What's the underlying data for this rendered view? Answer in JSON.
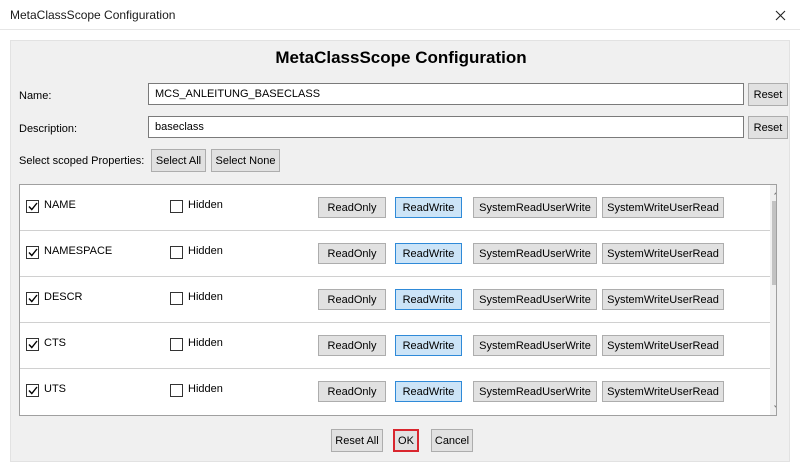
{
  "window": {
    "title": "MetaClassScope Configuration"
  },
  "header": {
    "title": "MetaClassScope Configuration"
  },
  "form": {
    "name_label": "Name:",
    "name_value": "MCS_ANLEITUNG_BASECLASS",
    "description_label": "Description:",
    "description_value": "baseclass",
    "reset_label": "Reset",
    "select_label": "Select scoped Properties:",
    "select_all_label": "Select All",
    "select_none_label": "Select None"
  },
  "rows": [
    {
      "name": "NAME",
      "checked": true,
      "hidden_label": "Hidden",
      "hidden": false,
      "mode": "ReadWrite"
    },
    {
      "name": "NAMESPACE",
      "checked": true,
      "hidden_label": "Hidden",
      "hidden": false,
      "mode": "ReadWrite"
    },
    {
      "name": "DESCR",
      "checked": true,
      "hidden_label": "Hidden",
      "hidden": false,
      "mode": "ReadWrite"
    },
    {
      "name": "CTS",
      "checked": true,
      "hidden_label": "Hidden",
      "hidden": false,
      "mode": "ReadWrite"
    },
    {
      "name": "UTS",
      "checked": true,
      "hidden_label": "Hidden",
      "hidden": false,
      "mode": "ReadWrite"
    }
  ],
  "modes": [
    "ReadOnly",
    "ReadWrite",
    "SystemReadUserWrite",
    "SystemWriteUserRead"
  ],
  "footer": {
    "reset_all_label": "Reset All",
    "ok_label": "OK",
    "cancel_label": "Cancel"
  },
  "colors": {
    "active_mode": "#cce4f7",
    "active_border": "#2f8ad8",
    "ok_border": "#d9262e"
  }
}
